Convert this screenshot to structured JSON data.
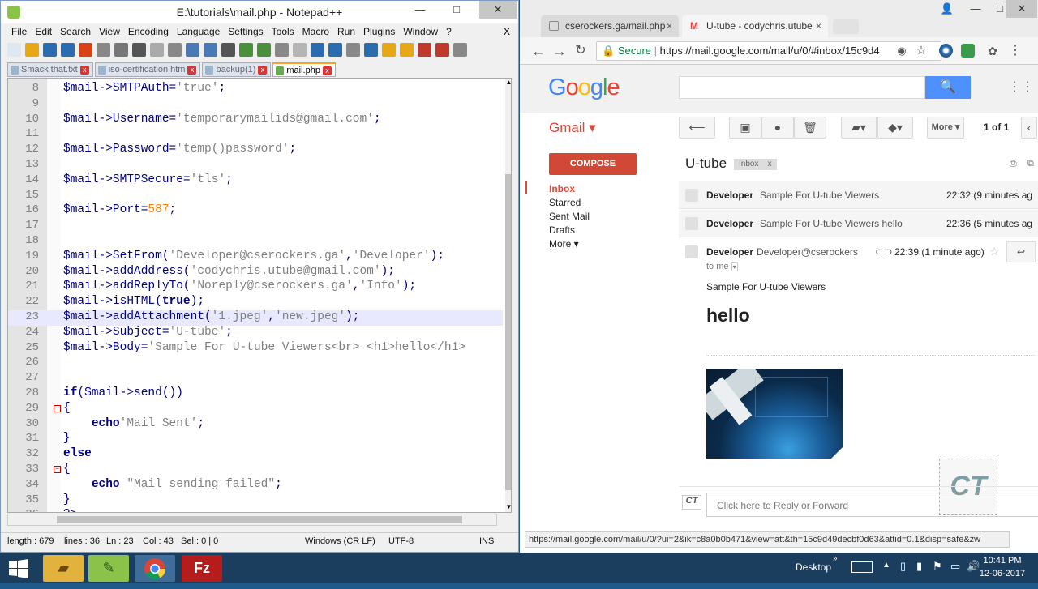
{
  "notepad": {
    "title": "E:\\tutorials\\mail.php - Notepad++",
    "menu": [
      "File",
      "Edit",
      "Search",
      "View",
      "Encoding",
      "Language",
      "Settings",
      "Tools",
      "Macro",
      "Run",
      "Plugins",
      "Window",
      "?"
    ],
    "menu_close": "X",
    "tabs": [
      {
        "label": "Smack that.txt",
        "active": false
      },
      {
        "label": "iso-certification.htm",
        "active": false
      },
      {
        "label": "backup(1)",
        "active": false
      },
      {
        "label": "mail.php",
        "active": true
      }
    ],
    "status": {
      "length": "length : 679",
      "lines": "lines : 36",
      "ln": "Ln : 23",
      "col": "Col : 43",
      "sel": "Sel : 0 | 0",
      "eol": "Windows (CR LF)",
      "encoding": "UTF-8",
      "mode": "INS"
    }
  },
  "code_lines": [
    {
      "n": "8",
      "code": "$mail->SMTPAuth='true';"
    },
    {
      "n": "9",
      "code": ""
    },
    {
      "n": "10",
      "code": "$mail->Username='temporarymailids@gmail.com';"
    },
    {
      "n": "11",
      "code": ""
    },
    {
      "n": "12",
      "code": "$mail->Password='temp()password';"
    },
    {
      "n": "13",
      "code": ""
    },
    {
      "n": "14",
      "code": "$mail->SMTPSecure='tls';"
    },
    {
      "n": "15",
      "code": ""
    },
    {
      "n": "16",
      "code": "$mail->Port=587;"
    },
    {
      "n": "17",
      "code": ""
    },
    {
      "n": "18",
      "code": ""
    },
    {
      "n": "19",
      "code": "$mail->SetFrom('Developer@cserockers.ga','Developer');"
    },
    {
      "n": "20",
      "code": "$mail->addAddress('codychris.utube@gmail.com');"
    },
    {
      "n": "21",
      "code": "$mail->addReplyTo('Noreply@cserockers.ga','Info');"
    },
    {
      "n": "22",
      "code": "$mail->isHTML(true);"
    },
    {
      "n": "23",
      "code": "$mail->addAttachment('1.jpeg','new.jpeg');"
    },
    {
      "n": "24",
      "code": "$mail->Subject='U-tube';"
    },
    {
      "n": "25",
      "code": "$mail->Body='Sample For U-tube Viewers<br> <h1>hello</h1>"
    },
    {
      "n": "26",
      "code": ""
    },
    {
      "n": "27",
      "code": ""
    },
    {
      "n": "28",
      "code": "if($mail->send())"
    },
    {
      "n": "29",
      "code": "{"
    },
    {
      "n": "30",
      "code": "    echo'Mail Sent';"
    },
    {
      "n": "31",
      "code": "}"
    },
    {
      "n": "32",
      "code": "else"
    },
    {
      "n": "33",
      "code": "{"
    },
    {
      "n": "34",
      "code": "    echo \"Mail sending failed\";"
    },
    {
      "n": "35",
      "code": "}"
    },
    {
      "n": "36",
      "code": "?>"
    }
  ],
  "chrome": {
    "tabs": [
      {
        "label": "cserockers.ga/mail.php",
        "close": "×"
      },
      {
        "label": "U-tube - codychris.utube",
        "close": "×"
      }
    ],
    "secure": "Secure",
    "url": "https://mail.google.com/mail/u/0/#inbox/15c9d4",
    "status_url": "https://mail.google.com/mail/u/0/?ui=2&ik=c8a0b0b471&view=att&th=15c9d49decbf0d63&attid=0.1&disp=safe&zw"
  },
  "gmail": {
    "logo": "Google",
    "label": "Gmail ▾",
    "compose": "COMPOSE",
    "nav": [
      "Inbox",
      "Starred",
      "Sent Mail",
      "Drafts",
      "More ▾"
    ],
    "more_button": "More ▾",
    "pager": "1 of 1",
    "subject": "U-tube",
    "badge": "Inbox",
    "badge_x": "x",
    "messages": [
      {
        "sender": "Developer",
        "snippet": "Sample For U-tube Viewers",
        "time": "22:32 (9 minutes ag"
      },
      {
        "sender": "Developer",
        "snippet": "Sample For U-tube Viewers hello",
        "time": "22:36 (5 minutes ag"
      }
    ],
    "open_message": {
      "sender": "Developer",
      "email": "Developer@cserockers",
      "time": "22:39 (1 minute ago)",
      "to": "to me",
      "body_text": "Sample For U-tube Viewers",
      "heading": "hello"
    },
    "reply_prefix": "Click here to ",
    "reply_link": "Reply",
    "reply_or": " or ",
    "forward_link": "Forward"
  },
  "taskbar": {
    "desktop": "Desktop",
    "time": "10:41 PM",
    "date": "12-06-2017"
  }
}
